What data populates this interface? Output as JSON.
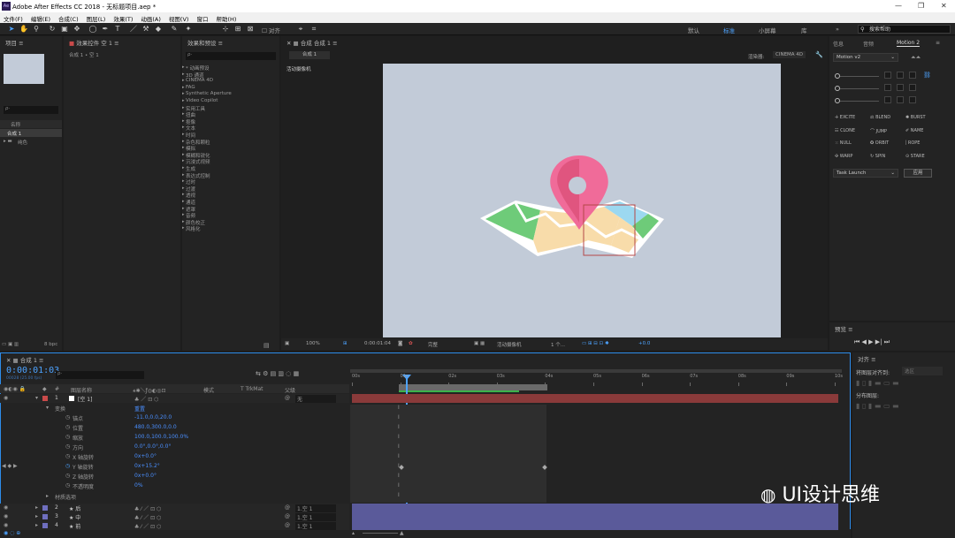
{
  "window": {
    "title": "Adobe After Effects CC 2018 - 无标题项目.aep *",
    "logo": "Ae"
  },
  "menu": [
    "文件(F)",
    "编辑(E)",
    "合成(C)",
    "图层(L)",
    "效果(T)",
    "动画(A)",
    "视图(V)",
    "窗口",
    "帮助(H)"
  ],
  "toolbar": {
    "align_label": "对齐",
    "workspaces": [
      "默认",
      "标准",
      "小屏幕",
      "库"
    ],
    "active_workspace": "标准",
    "search_placeholder": "搜索帮助"
  },
  "project_panel": {
    "title": "项目",
    "fx_controls_title": "效果控件 空 1",
    "breadcrumb": "合成 1 • 空 1",
    "search_placeholder": "ρ·",
    "name_header": "名称",
    "items": [
      "合成 1",
      "纯色"
    ],
    "bpc": "8 bpc"
  },
  "effects_panel": {
    "title": "效果和预设",
    "items": [
      "* 动画预设",
      "3D 通道",
      "CINEMA 4D",
      "FAG",
      "Synthetic Aperture",
      "Video Copilot",
      "实用工具",
      "扭曲",
      "抠像",
      "文本",
      "时间",
      "杂色和颗粒",
      "模拟",
      "模糊和锐化",
      "沉浸式视频",
      "生成",
      "表达式控制",
      "过时",
      "过渡",
      "透视",
      "通道",
      "遮罩",
      "音频",
      "颜色校正",
      "风格化"
    ]
  },
  "comp_panel": {
    "title": "合成 合成 1",
    "tab": "合成 1",
    "renderer_label": "渲染器:",
    "renderer": "CINEMA 4D",
    "camera_label": "活动摄像机",
    "footer": {
      "zoom": "100%",
      "timecode": "0:00:01:04",
      "quality": "完整",
      "camera": "活动摄像机",
      "views": "1 个...",
      "exposure": "+0.0"
    }
  },
  "motion_panel": {
    "tabs": [
      "信息",
      "音频",
      "Motion 2"
    ],
    "active_tab": "Motion 2",
    "dropdown": "Motion v2",
    "buttons": [
      "EXCITE",
      "BLEND",
      "BURST",
      "CLONE",
      "JUMP",
      "NAME",
      "NULL",
      "ORBIT",
      "ROPE",
      "WARP",
      "SPIN",
      "STARE"
    ],
    "task_dropdown": "Task Launch",
    "apply_button": "应用"
  },
  "preview_panel": {
    "title": "预览"
  },
  "timeline": {
    "comp_tab": "合成 1",
    "timecode": "0:00:01:03",
    "frame_info": "00028 (25.00 fps)",
    "columns": {
      "num": "#",
      "name": "图层名称",
      "mode": "模式",
      "trkmat": "T TrkMat",
      "parent": "父级"
    },
    "layers": [
      {
        "num": "1",
        "name": "[空 1]",
        "parent": "无",
        "color": "#c94a4a"
      },
      {
        "num": "2",
        "name": "★ 后",
        "parent": "1.空 1",
        "color": "#6f6fbf"
      },
      {
        "num": "3",
        "name": "★ 中",
        "parent": "1.空 1",
        "color": "#6f6fbf"
      },
      {
        "num": "4",
        "name": "★ 前",
        "parent": "1.空 1",
        "color": "#6f6fbf"
      }
    ],
    "transform": {
      "group": "变换",
      "reset": "重置",
      "props": [
        {
          "label": "锚点",
          "value": "-11.0,0.0,20.0"
        },
        {
          "label": "位置",
          "value": "480.0,300.0,0.0"
        },
        {
          "label": "缩放",
          "value": "100.0,100.0,100.0%"
        },
        {
          "label": "方向",
          "value": "0.0°,0.0°,0.0°"
        },
        {
          "label": "X 轴旋转",
          "value": "0x+0.0°"
        },
        {
          "label": "Y 轴旋转",
          "value": "0x+15.2°"
        },
        {
          "label": "Z 轴旋转",
          "value": "0x+0.0°"
        },
        {
          "label": "不透明度",
          "value": "0%"
        }
      ],
      "material": "材质选项"
    },
    "ruler": [
      "00s",
      "01s",
      "02s",
      "03s",
      "04s",
      "05s",
      "06s",
      "07s",
      "08s",
      "09s",
      "10s"
    ]
  },
  "align_panel": {
    "title": "对齐",
    "align_to_label": "将图层对齐到:",
    "align_to": "选区",
    "distribute_label": "分布图层:"
  },
  "watermark": {
    "text": "UI设计思维"
  },
  "colors": {
    "accent": "#2d8ceb",
    "stage_bg": "#c2cbd8",
    "pin": "#f06b99",
    "layer_red": "#8a3a3a",
    "layer_blue": "#5a5a9a"
  }
}
